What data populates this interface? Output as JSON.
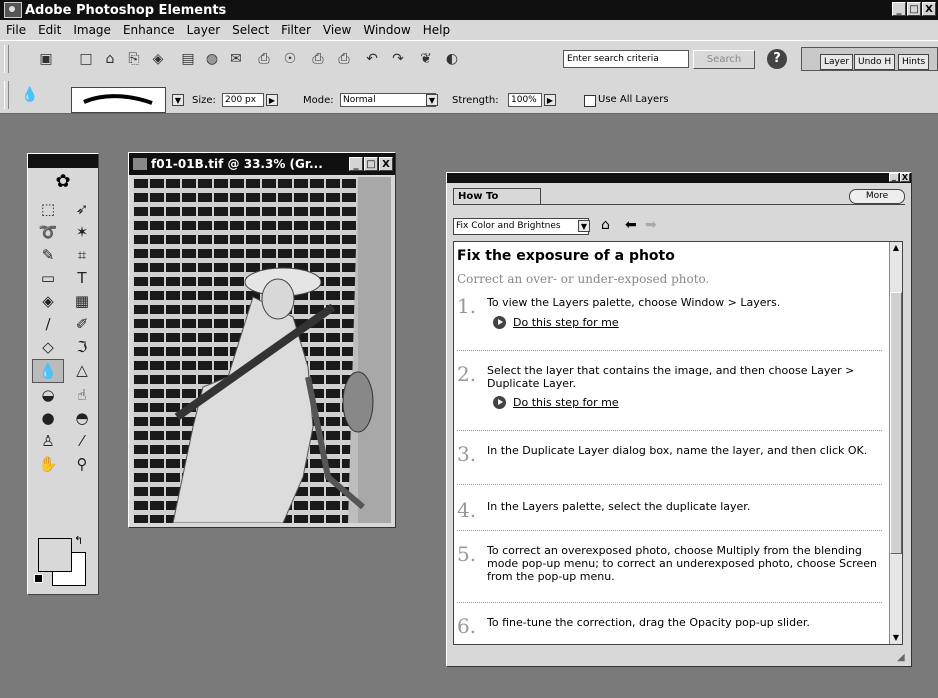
{
  "app": {
    "title": "Adobe Photoshop Elements"
  },
  "window_buttons": [
    "_",
    "□",
    "X"
  ],
  "menu": [
    "File",
    "Edit",
    "Image",
    "Enhance",
    "Layer",
    "Select",
    "Filter",
    "View",
    "Window",
    "Help"
  ],
  "toolbar": {
    "search_placeholder": "Enter search criteria",
    "search_button": "Search",
    "help_button": "?",
    "palette_tabs": [
      "Layer",
      "Undo H",
      "Hints"
    ]
  },
  "options": {
    "size_label": "Size:",
    "size_value": "200 px",
    "mode_label": "Mode:",
    "mode_value": "Normal",
    "strength_label": "Strength:",
    "strength_value": "100%",
    "use_all_layers": "Use All Layers"
  },
  "document": {
    "title": "f01-01B.tif @ 33.3% (Gr..."
  },
  "howto": {
    "tab": "How To",
    "more_button": "More",
    "topic": "Fix Color and Brightnes",
    "heading": "Fix the exposure of a photo",
    "subtitle": "Correct an over- or under-exposed photo.",
    "link_label": "Do this step for me",
    "steps": [
      {
        "num": "1.",
        "text": "To view the Layers palette, choose Window > Layers."
      },
      {
        "num": "2.",
        "text": "Select the layer that contains the image, and then choose Layer > Duplicate Layer."
      },
      {
        "num": "3.",
        "text": "In the Duplicate Layer dialog box, name the layer, and then click OK."
      },
      {
        "num": "4.",
        "text": "In the Layers palette, select the duplicate layer."
      },
      {
        "num": "5.",
        "text": "To correct an overexposed photo, choose Multiply from the blending mode pop-up menu; to correct an underexposed photo, choose Screen from the pop-up menu."
      },
      {
        "num": "6.",
        "text": "To fine-tune the correction, drag the Opacity pop-up slider."
      }
    ]
  }
}
